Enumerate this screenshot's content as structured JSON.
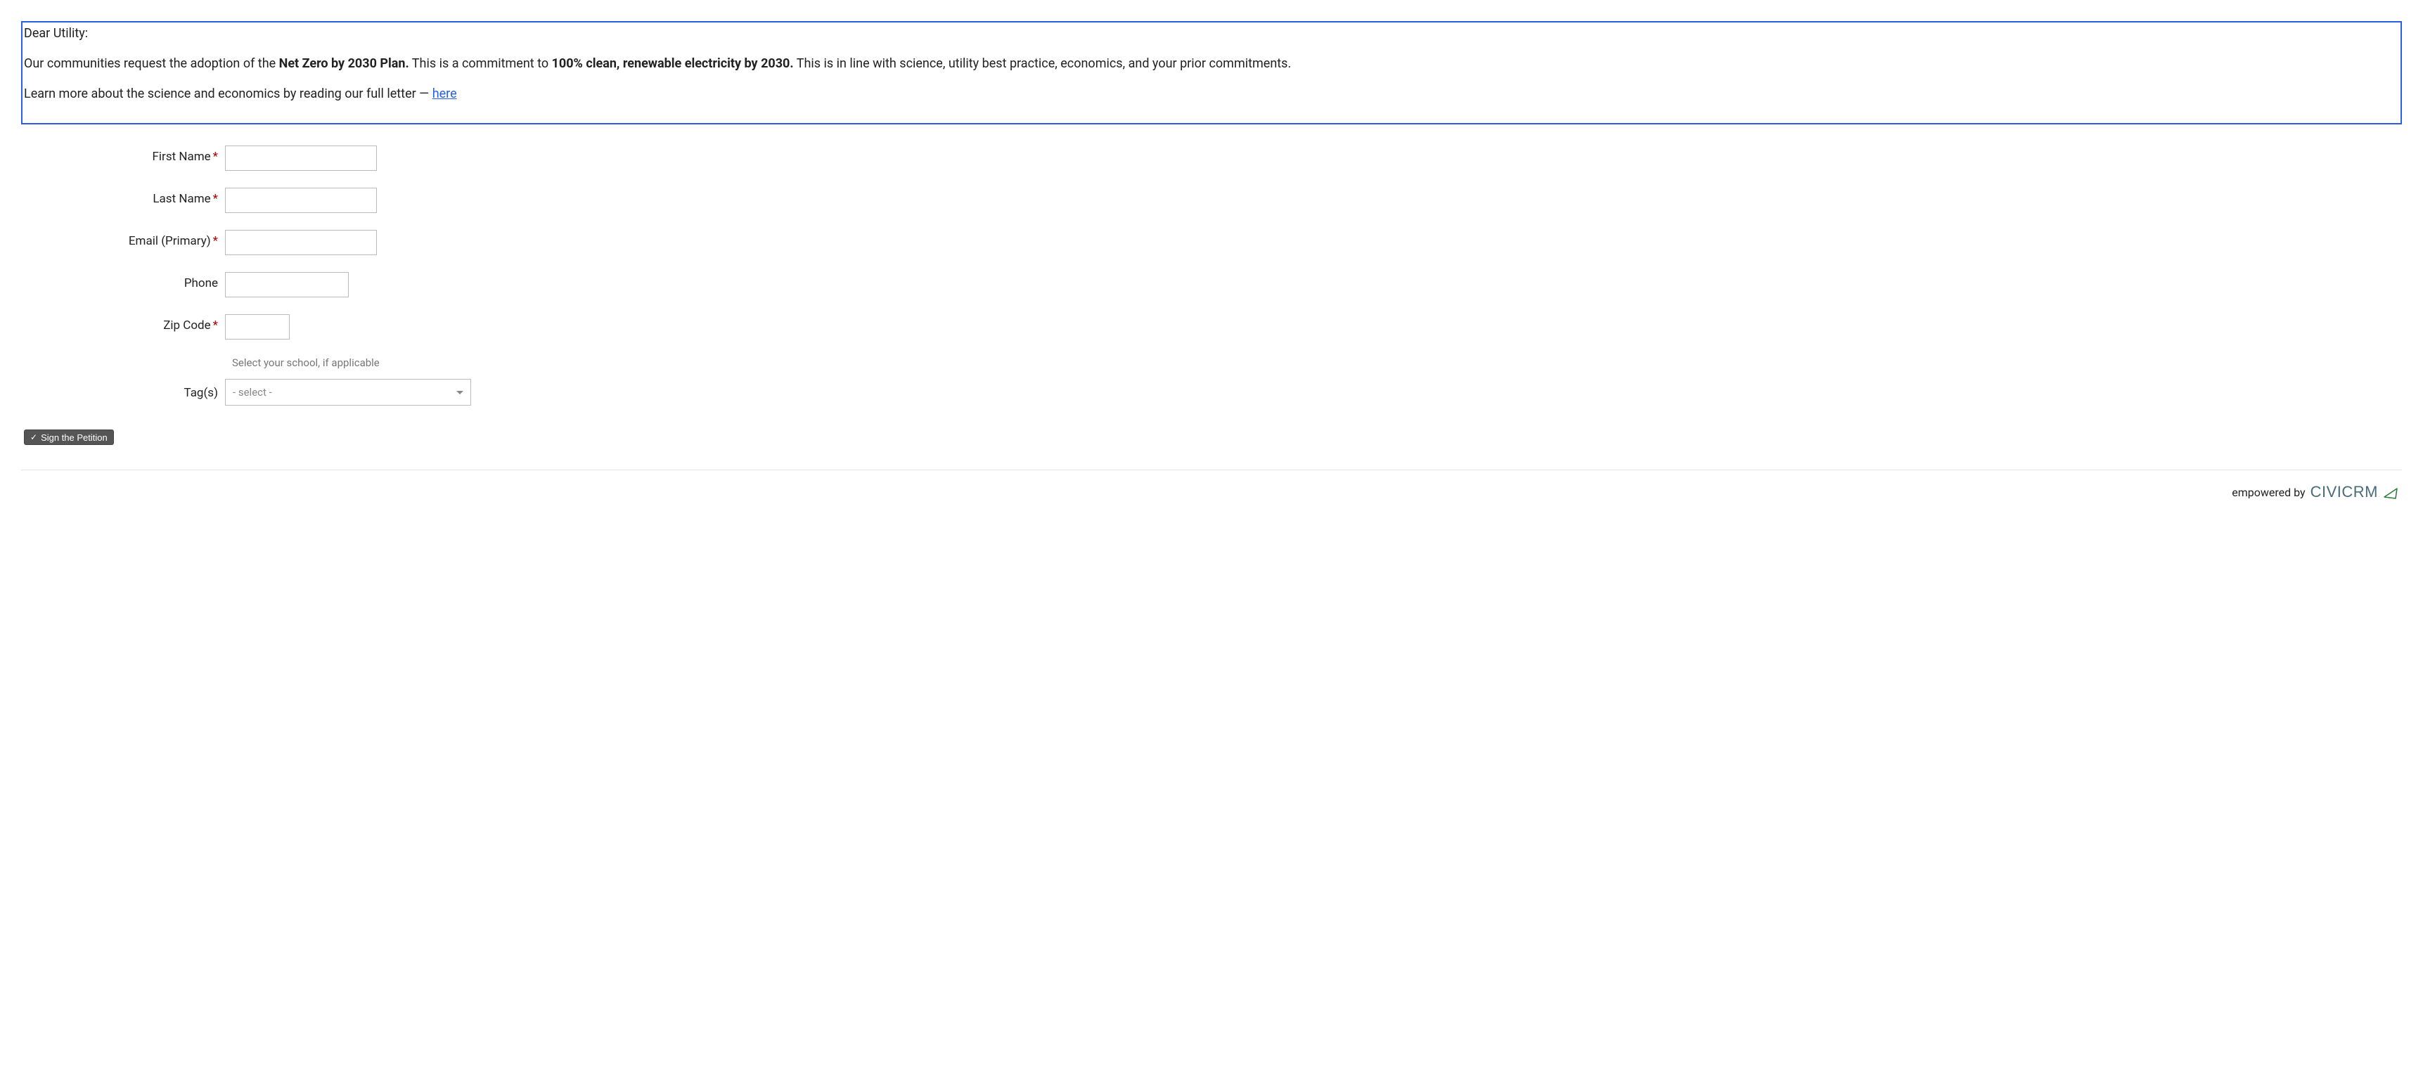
{
  "intro": {
    "greeting": "Dear Utility:",
    "sentence_prefix": "Our communities request the adoption of the ",
    "bold1": "Net Zero by 2030 Plan.",
    "sentence_mid": " This is a commitment to ",
    "bold2": "100% clean, renewable electricity by 2030.",
    "sentence_suffix": " This is in line with science, utility best practice, economics, and your prior commitments.",
    "learn_prefix": "Learn more about the science and economics by reading our full letter — ",
    "learn_link": "here"
  },
  "form": {
    "first_name_label": "First Name",
    "last_name_label": "Last Name",
    "email_label": "Email (Primary)",
    "phone_label": "Phone",
    "zip_label": "Zip Code",
    "tags_label": "Tag(s)",
    "tags_help": "Select your school, if applicable",
    "tags_placeholder": "- select -",
    "required_mark": "*",
    "submit_label": "Sign the Petition"
  },
  "footer": {
    "empowered": "empowered by",
    "brand_civi": "CIVI",
    "brand_crm": "CRM"
  }
}
